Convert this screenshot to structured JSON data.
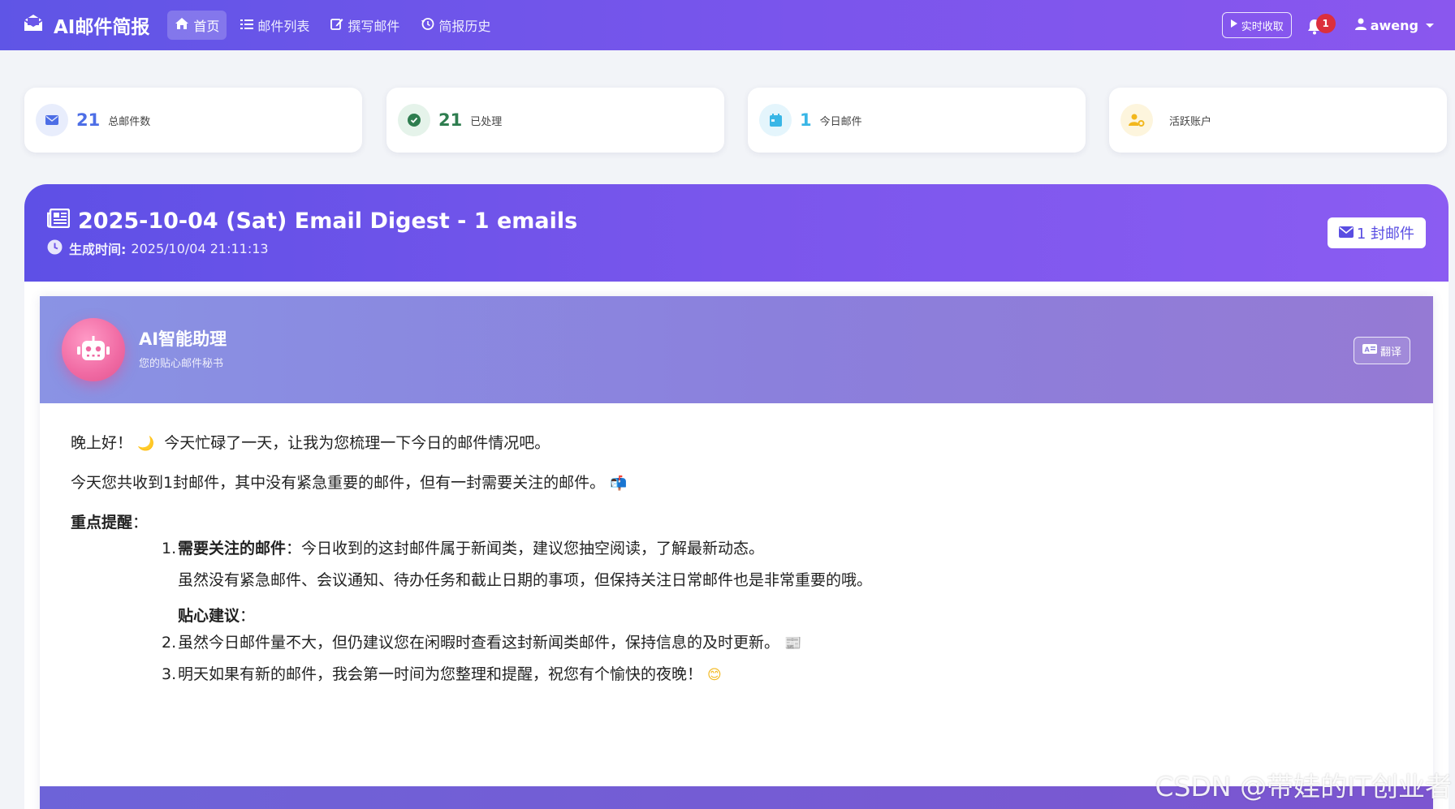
{
  "navbar": {
    "brand": "AI邮件简报",
    "links": [
      {
        "label": "首页",
        "icon": "home-icon",
        "active": true
      },
      {
        "label": "邮件列表",
        "icon": "list-icon"
      },
      {
        "label": "撰写邮件",
        "icon": "edit-icon"
      },
      {
        "label": "简报历史",
        "icon": "history-icon"
      }
    ],
    "realtime_button": "实时收取",
    "notification_count": "1",
    "username": "aweng"
  },
  "stats": [
    {
      "value": "21",
      "label": "总邮件数",
      "icon": "envelope-icon",
      "color": "#4d6ee6",
      "bg": "#e8edfc"
    },
    {
      "value": "21",
      "label": "已处理",
      "icon": "check-circle-icon",
      "color": "#2e7d4f",
      "bg": "#e5f3ea"
    },
    {
      "value": "1",
      "label": "今日邮件",
      "icon": "calendar-icon",
      "color": "#39b6e6",
      "bg": "#e4f5fc"
    },
    {
      "value": "",
      "label": "活跃账户",
      "icon": "user-gear-icon",
      "color": "#f2b71c",
      "bg": "#fdf5dd"
    }
  ],
  "digest": {
    "title": "2025-10-04 (Sat) Email Digest - 1 emails",
    "time_label": "生成时间:",
    "time_value": "2025/10/04 21:11:13",
    "count_button": "1 封邮件"
  },
  "assistant": {
    "name": "AI智能助理",
    "subtitle": "您的贴心邮件秘书",
    "translate_button": "翻译",
    "greeting": "晚上好！",
    "greeting_emoji": "🌙",
    "greeting_rest": "今天忙碌了一天，让我为您梳理一下今日的邮件情况吧。",
    "summary": "今天您共收到1封邮件，其中没有紧急重要的邮件，但有一封需要关注的邮件。",
    "summary_emoji": "📬",
    "highlights_label": "重点提醒",
    "item1_num": "1.",
    "item1_bold": "需要关注的邮件",
    "item1_text": "：今日收到的这封邮件属于新闻类，建议您抽空阅读，了解最新动态。",
    "item1_extra": "虽然没有紧急邮件、会议通知、待办任务和截止日期的事项，但保持关注日常邮件也是非常重要的哦。",
    "tips_label": "贴心建议",
    "item2_num": "2.",
    "item2_text": "虽然今日邮件量不大，但仍建议您在闲暇时查看这封新闻类邮件，保持信息的及时更新。",
    "item2_emoji": "📰",
    "item3_num": "3.",
    "item3_text": "明天如果有新的邮件，我会第一时间为您整理和提醒，祝您有个愉快的夜晚！",
    "item3_emoji": "😊"
  },
  "watermark": "CSDN @带娃的IT创业者"
}
